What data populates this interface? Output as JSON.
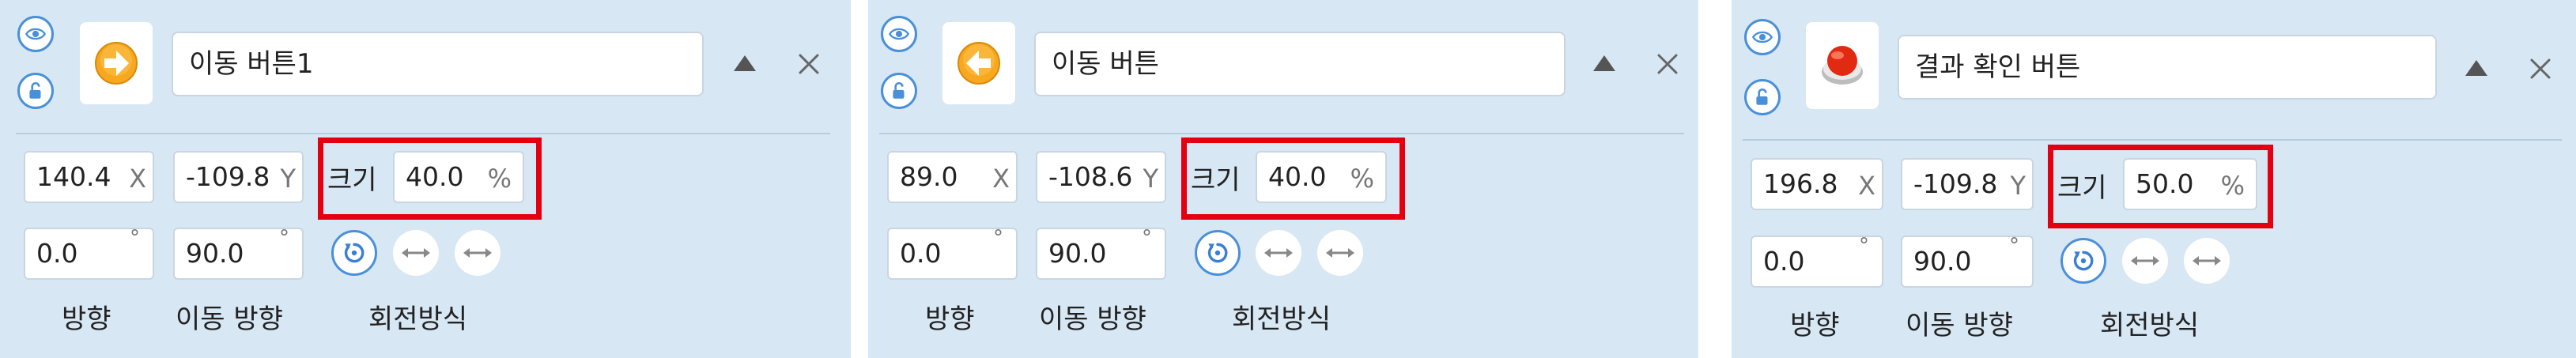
{
  "panels": [
    {
      "name": "이동 버튼1",
      "x": "140.4",
      "x_unit": "X",
      "y": "-109.8",
      "y_unit": "Y",
      "size_label": "크기",
      "size": "40.0",
      "size_unit": "%",
      "direction": "0.0",
      "move_direction": "90.0",
      "deg": "°",
      "direction_label": "방향",
      "move_direction_label": "이동 방향",
      "rotation_label": "회전방식",
      "sprite_icon": "arrow-right-icon"
    },
    {
      "name": "이동 버튼",
      "x": "89.0",
      "x_unit": "X",
      "y": "-108.6",
      "y_unit": "Y",
      "size_label": "크기",
      "size": "40.0",
      "size_unit": "%",
      "direction": "0.0",
      "move_direction": "90.0",
      "deg": "°",
      "direction_label": "방향",
      "move_direction_label": "이동 방향",
      "rotation_label": "회전방식",
      "sprite_icon": "arrow-left-icon"
    },
    {
      "name": "결과 확인 버튼",
      "x": "196.8",
      "x_unit": "X",
      "y": "-109.8",
      "y_unit": "Y",
      "size_label": "크기",
      "size": "50.0",
      "size_unit": "%",
      "direction": "0.0",
      "move_direction": "90.0",
      "deg": "°",
      "direction_label": "방향",
      "move_direction_label": "이동 방향",
      "rotation_label": "회전방식",
      "sprite_icon": "red-circle-button-icon"
    }
  ],
  "colors": {
    "panel_bg": "#d7e7f4",
    "accent": "#4a90d9",
    "highlight": "#e4000f",
    "sprite_orange": "#f5a623",
    "sprite_red": "#e22a12"
  }
}
